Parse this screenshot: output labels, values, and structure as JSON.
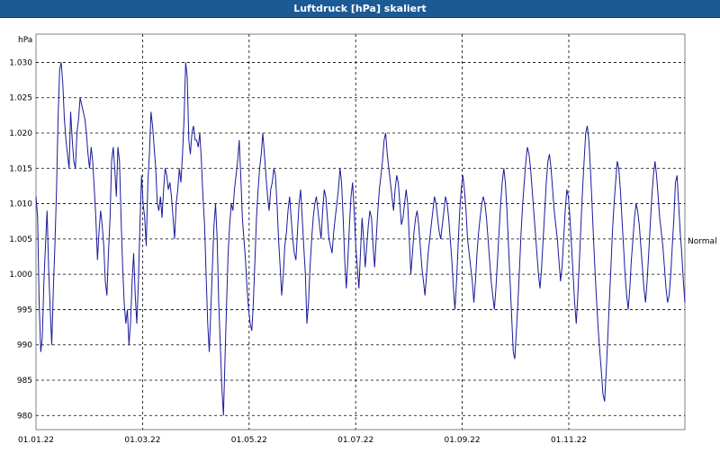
{
  "chart_data": {
    "type": "line",
    "title": "Luftdruck [hPa] skaliert",
    "ylabel": "hPa",
    "xlabel": "",
    "ylim": [
      978,
      1034
    ],
    "yticks": [
      980,
      985,
      990,
      995,
      1000,
      1005,
      1010,
      1015,
      1020,
      1025,
      1030
    ],
    "ytick_labels": [
      "980",
      "985",
      "990",
      "995",
      "1.000",
      "1.005",
      "1.010",
      "1.015",
      "1.020",
      "1.025",
      "1.030"
    ],
    "xticks": [
      "01.01.22",
      "01.03.22",
      "01.05.22",
      "01.07.22",
      "01.09.22",
      "01.11.22"
    ],
    "grid": true,
    "reference_label": "Normal",
    "reference_value": 1005,
    "colors": {
      "line": "#1a1a9a",
      "title_bg": "#1c5a96"
    },
    "series": [
      {
        "values": [
          1011,
          1008,
          996,
          989,
          991,
          999,
          1004,
          1009,
          1001,
          995,
          990,
          998,
          1004,
          1012,
          1022,
          1029,
          1030,
          1027,
          1022,
          1019,
          1017,
          1015,
          1023,
          1019,
          1016,
          1015,
          1020,
          1022,
          1025,
          1024,
          1023,
          1022,
          1020,
          1017,
          1015,
          1018,
          1016,
          1012,
          1008,
          1002,
          1006,
          1009,
          1007,
          1004,
          999,
          997,
          1003,
          1008,
          1016,
          1018,
          1015,
          1011,
          1018,
          1016,
          1008,
          1001,
          996,
          993,
          995,
          990,
          993,
          999,
          1003,
          997,
          993,
          999,
          1007,
          1014,
          1010,
          1008,
          1004,
          1013,
          1017,
          1023,
          1021,
          1018,
          1015,
          1010,
          1009,
          1011,
          1008,
          1012,
          1015,
          1014,
          1012,
          1013,
          1011,
          1008,
          1005,
          1010,
          1012,
          1015,
          1013,
          1017,
          1022,
          1030,
          1028,
          1019,
          1017,
          1020,
          1021,
          1019,
          1019,
          1018,
          1020,
          1016,
          1011,
          1007,
          1000,
          993,
          989,
          995,
          1001,
          1007,
          1010,
          1005,
          996,
          990,
          984,
          980,
          988,
          996,
          1003,
          1007,
          1010,
          1009,
          1012,
          1014,
          1016,
          1019,
          1014,
          1008,
          1005,
          1002,
          998,
          995,
          993,
          992,
          996,
          1002,
          1008,
          1012,
          1015,
          1017,
          1020,
          1017,
          1014,
          1011,
          1009,
          1012,
          1013,
          1015,
          1014,
          1010,
          1005,
          1001,
          997,
          1000,
          1004,
          1006,
          1009,
          1011,
          1008,
          1005,
          1003,
          1002,
          1006,
          1010,
          1012,
          1008,
          1004,
          1000,
          993,
          996,
          1001,
          1005,
          1008,
          1010,
          1011,
          1009,
          1007,
          1005,
          1009,
          1012,
          1011,
          1008,
          1005,
          1004,
          1003,
          1006,
          1008,
          1010,
          1012,
          1015,
          1013,
          1008,
          1002,
          998,
          1002,
          1007,
          1011,
          1013,
          1009,
          1004,
          1001,
          998,
          1003,
          1008,
          1005,
          1001,
          1004,
          1007,
          1009,
          1008,
          1004,
          1001,
          1005,
          1009,
          1012,
          1014,
          1016,
          1019,
          1020,
          1017,
          1015,
          1013,
          1011,
          1009,
          1012,
          1014,
          1013,
          1010,
          1007,
          1008,
          1010,
          1012,
          1010,
          1005,
          1000,
          1003,
          1006,
          1008,
          1009,
          1007,
          1004,
          1001,
          999,
          997,
          1000,
          1003,
          1005,
          1007,
          1009,
          1011,
          1010,
          1008,
          1006,
          1005,
          1007,
          1009,
          1011,
          1010,
          1008,
          1005,
          1002,
          998,
          995,
          999,
          1004,
          1009,
          1012,
          1014,
          1012,
          1009,
          1005,
          1003,
          1001,
          999,
          996,
          999,
          1003,
          1006,
          1008,
          1010,
          1011,
          1010,
          1008,
          1005,
          1002,
          999,
          997,
          995,
          998,
          1002,
          1006,
          1010,
          1013,
          1015,
          1013,
          1009,
          1004,
          999,
          994,
          989,
          988,
          992,
          996,
          1001,
          1006,
          1010,
          1013,
          1016,
          1018,
          1017,
          1015,
          1012,
          1009,
          1006,
          1003,
          1000,
          998,
          1001,
          1005,
          1009,
          1013,
          1016,
          1017,
          1015,
          1012,
          1009,
          1007,
          1005,
          1002,
          999,
          1001,
          1005,
          1009,
          1012,
          1011,
          1008,
          1004,
          1000,
          996,
          993,
          997,
          1002,
          1007,
          1012,
          1016,
          1020,
          1021,
          1019,
          1015,
          1010,
          1005,
          1000,
          996,
          992,
          989,
          986,
          983,
          982,
          986,
          991,
          996,
          1001,
          1006,
          1010,
          1013,
          1016,
          1015,
          1012,
          1008,
          1004,
          1000,
          997,
          995,
          998,
          1002,
          1005,
          1008,
          1010,
          1009,
          1007,
          1004,
          1001,
          998,
          996,
          999,
          1003,
          1007,
          1011,
          1014,
          1016,
          1014,
          1011,
          1008,
          1006,
          1004,
          1001,
          998,
          996,
          997,
          1000,
          1004,
          1008,
          1013,
          1014,
          1010,
          1006,
          1003,
          999,
          996
        ]
      }
    ]
  }
}
